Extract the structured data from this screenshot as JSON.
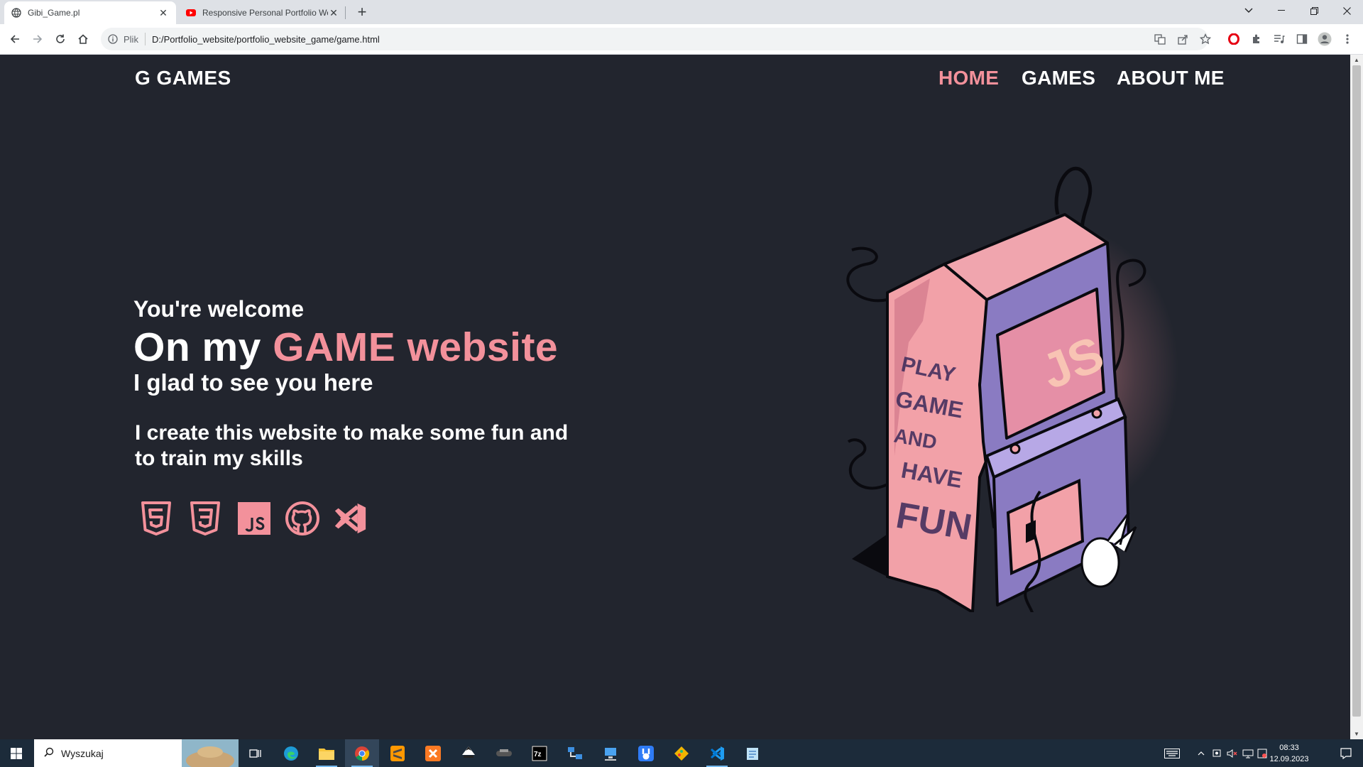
{
  "browser": {
    "tabs": [
      {
        "title": "Gibi_Game.pl",
        "active": true
      },
      {
        "title": "Responsive Personal Portfolio We",
        "active": false
      }
    ],
    "url_scheme": "Plik",
    "url": "D:/Portfolio_website/portfolio_website_game/game.html"
  },
  "site": {
    "logo": "G GAMES",
    "nav": [
      {
        "label": "HOME",
        "active": true
      },
      {
        "label": "GAMES",
        "active": false
      },
      {
        "label": "ABOUT ME",
        "active": false
      }
    ],
    "hero": {
      "welcome": "You're welcome",
      "title_prefix": "On my ",
      "title_accent": "GAME website",
      "subtitle": "I glad to see you here",
      "description": "I create this website to make some fun and to train my skills"
    },
    "tech_icons": [
      "html5-icon",
      "css3-icon",
      "javascript-icon",
      "github-icon",
      "vscode-icon"
    ],
    "art": {
      "screen_text": "JS",
      "side_text": [
        "PLAY",
        "GAME",
        "AND",
        "HAVE",
        "FUN"
      ]
    },
    "colors": {
      "accent": "#f3919b",
      "background": "#22252e"
    }
  },
  "taskbar": {
    "search_placeholder": "Wyszukaj",
    "time": "08:33",
    "date": "12.09.2023"
  }
}
